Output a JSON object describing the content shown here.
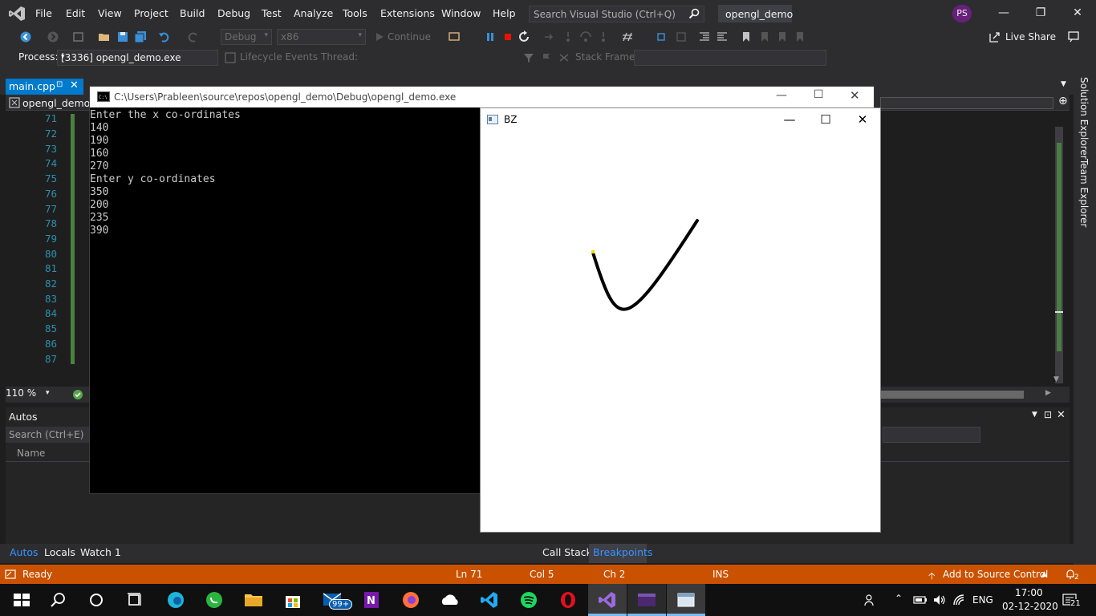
{
  "menubar": {
    "items": [
      "File",
      "Edit",
      "View",
      "Project",
      "Build",
      "Debug",
      "Test",
      "Analyze",
      "Tools",
      "Extensions",
      "Window",
      "Help"
    ],
    "search_placeholder": "Search Visual Studio (Ctrl+Q)",
    "project_title": "opengl_demo",
    "avatar_initials": "PS"
  },
  "toolbar": {
    "config": "Debug",
    "platform": "x86",
    "continue_label": "Continue",
    "live_share": "Live Share"
  },
  "debugbar": {
    "process_label": "Process:",
    "process_value": "[3336] opengl_demo.exe",
    "lifecycle_label": "Lifecycle Events",
    "thread_label": "Thread:",
    "stack_frame_label": "Stack Frame:"
  },
  "editor": {
    "tab_name": "main.cpp",
    "nav_project": "opengl_demo",
    "line_numbers": [
      "71",
      "72",
      "73",
      "74",
      "75",
      "76",
      "77",
      "78",
      "79",
      "80",
      "81",
      "82",
      "83",
      "84",
      "85",
      "86",
      "87"
    ],
    "zoom": "110 %"
  },
  "right_strip": {
    "solution_explorer": "Solution Explorer",
    "team_explorer": "Team Explorer"
  },
  "autos": {
    "title": "Autos",
    "search_placeholder": "Search (Ctrl+E)",
    "col_name": "Name"
  },
  "bottom_tabs": {
    "left": [
      "Autos",
      "Locals",
      "Watch 1"
    ],
    "right": [
      "Call Stack",
      "Breakpoints"
    ]
  },
  "statusbar": {
    "ready": "Ready",
    "line": "Ln 71",
    "col": "Col 5",
    "ch": "Ch 2",
    "mode": "INS",
    "source_control": "Add to Source Control",
    "notifications": "2"
  },
  "console": {
    "title": "C:\\Users\\Prableen\\source\\repos\\opengl_demo\\Debug\\opengl_demo.exe",
    "lines": [
      "Enter the x co-ordinates",
      "140",
      "190",
      "160",
      "270",
      "Enter y co-ordinates",
      "350",
      "200",
      "235",
      "390"
    ]
  },
  "bz_window": {
    "title": "BZ",
    "curve_color": "#000000",
    "start_point_color": "#ffd800"
  },
  "taskbar": {
    "mail_badge": "99+",
    "lang": "ENG",
    "time": "17:00",
    "date": "02-12-2020",
    "notification_count": "21"
  },
  "colors": {
    "accent": "#007acc",
    "status_orange": "#ca5100",
    "chrome": "#2d2d30"
  }
}
